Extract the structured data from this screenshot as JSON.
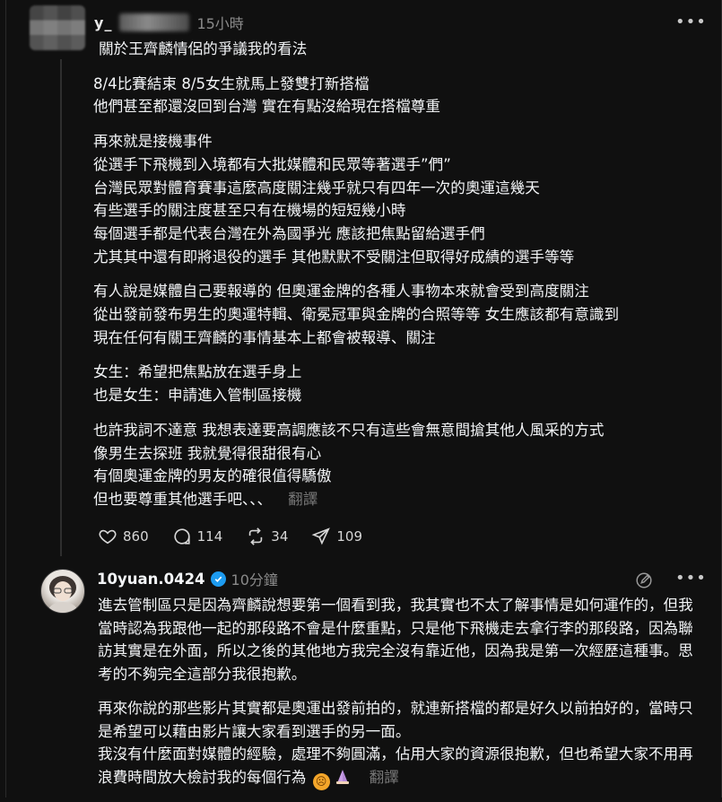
{
  "post": {
    "username": "y",
    "username_suffix": "_",
    "time": "15小時",
    "more_icon": "ellipsis-icon",
    "title": "關於王齊麟情侶的爭議我的看法",
    "paragraphs": [
      "8/4比賽結束 8/5女生就馬上發雙打新搭檔\n他們甚至都還沒回到台灣 實在有點沒給現在搭檔尊重",
      "再來就是接機事件\n從選手下飛機到入境都有大批媒體和民眾等著選手”們”\n台灣民眾對體育賽事這麼高度關注幾乎就只有四年一次的奧運這幾天\n有些選手的關注度甚至只有在機場的短短幾小時\n每個選手都是代表台灣在外為國爭光 應該把焦點留給選手們\n尤其其中還有即將退役的選手 其他默默不受關注但取得好成績的選手等等",
      "有人說是媒體自己要報導的 但奧運金牌的各種人事物本來就會受到高度關注\n從出發前發布男生的奧運特輯、衛冕冠軍與金牌的合照等等 女生應該都有意識到\n現在任何有關王齊麟的事情基本上都會被報導、關注",
      "女生：希望把焦點放在選手身上\n也是女生：申請進入管制區接機",
      "也許我詞不達意 我想表達要高調應該不只有這些會無意間搶其他人風采的方式\n像男生去探班 我就覺得很甜很有心\n有個奧運金牌的男友的確很值得驕傲\n但也要尊重其他選手吧、、、"
    ],
    "translate_label": "翻譯",
    "likes": "860",
    "comments": "114",
    "reposts": "34",
    "shares": "109"
  },
  "reply": {
    "username": "10yuan.0424",
    "time": "10分鐘",
    "paragraph1": "進去管制區只是因為齊麟說想要第一個看到我，我其實也不太了解事情是如何運作的，但我當時認為我跟他一起的那段路不會是什麼重點，只是他下飛機走去拿行李的那段路，因為聯訪其實是在外面，所以之後的其他地方我完全沒有靠近他，因為我是第一次經歷這種事。思考的不夠完全這部分我很抱歉。",
    "paragraph2a": "再來你說的那些影片其實都是奧運出發前拍的，就連新搭檔的都是好久以前拍好的，當時只是希望可以藉由影片讓大家看到選手的另一面。",
    "paragraph2b": "我沒有什麼面對媒體的經驗，處理不夠圓滿，佔用大家的資源很抱歉，但也希望大家不用再浪費時間放大檢討我的每個行為",
    "translate_label": "翻譯"
  }
}
